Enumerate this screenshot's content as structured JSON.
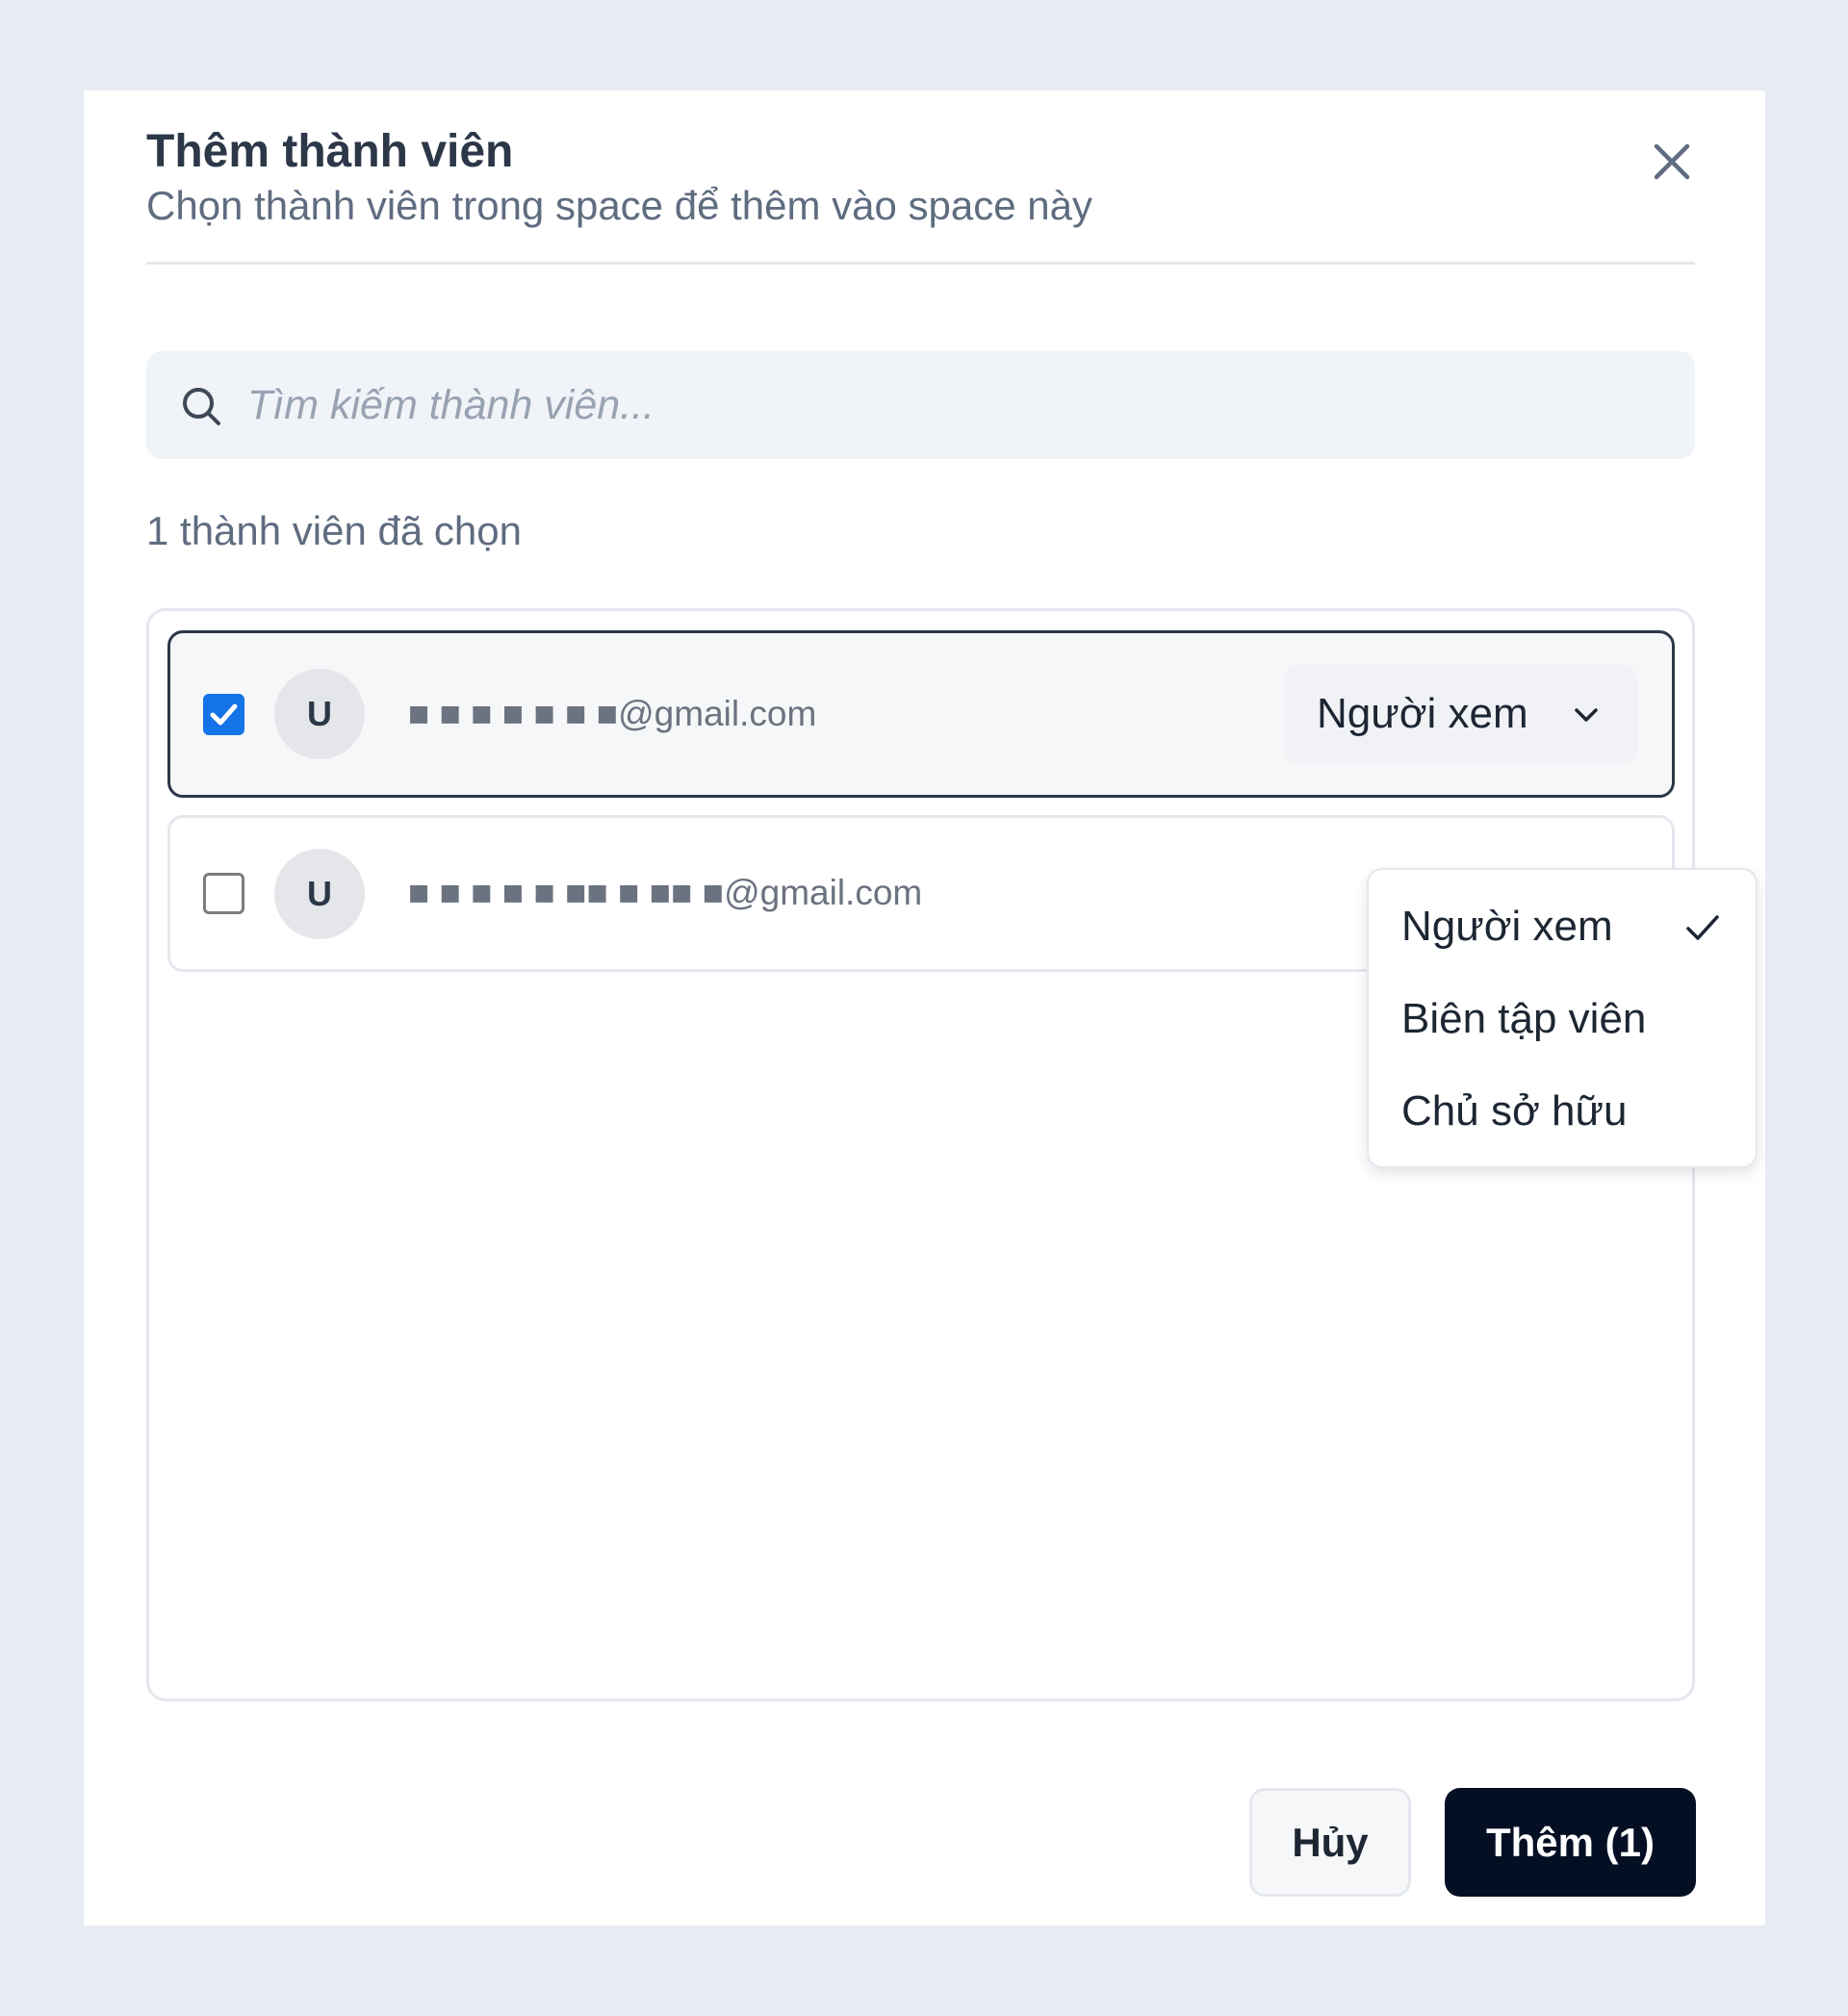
{
  "dialog": {
    "title": "Thêm thành viên",
    "subtitle": "Chọn thành viên trong space để thêm vào space này"
  },
  "search": {
    "placeholder": "Tìm kiếm thành viên...",
    "value": ""
  },
  "selection": {
    "count_text": "1 thành viên đã chọn"
  },
  "members": [
    {
      "avatar_initial": "U",
      "email": "■ ■ ■   ■   ■   ■ ■@gmail.com",
      "checked": true,
      "role": "Người xem"
    },
    {
      "avatar_initial": "U",
      "email": "■ ■ ■ ■ ■ ■■ ■ ■■ ■@gmail.com",
      "checked": false
    }
  ],
  "role_dropdown": {
    "options": [
      {
        "label": "Người xem",
        "selected": true
      },
      {
        "label": "Biên tập viên",
        "selected": false
      },
      {
        "label": "Chủ sở hữu",
        "selected": false
      }
    ]
  },
  "footer": {
    "cancel_label": "Hủy",
    "add_label": "Thêm (1)"
  },
  "colors": {
    "accent": "#1473e6",
    "primary_button": "#050f24",
    "page_background": "#e7ebf2"
  },
  "icons": {
    "close": "close-icon",
    "search": "search-icon",
    "chevron": "chevron-down-icon",
    "check": "checkmark-icon"
  }
}
